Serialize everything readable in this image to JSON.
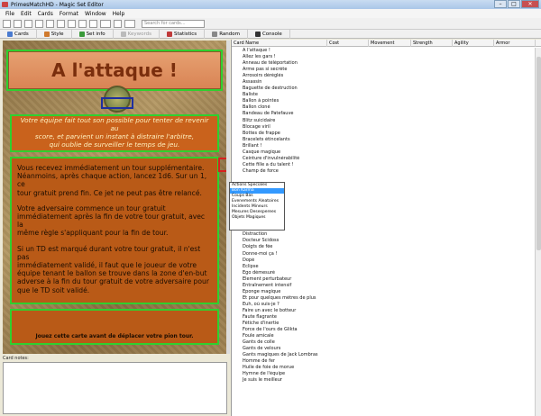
{
  "window": {
    "title": "PrimesMatchHD - Magic Set Editor",
    "buttons": [
      "–",
      "□",
      "✕"
    ]
  },
  "menu": [
    "File",
    "Edit",
    "Cards",
    "Format",
    "Window",
    "Help"
  ],
  "toolbar": {
    "search_placeholder": "Search for cards..."
  },
  "tabs": [
    {
      "label": "Cards",
      "icon": "cards-icon",
      "enabled": true
    },
    {
      "label": "Style",
      "icon": "style-icon",
      "enabled": true
    },
    {
      "label": "Set info",
      "icon": "set-info-icon",
      "enabled": true
    },
    {
      "label": "Keywords",
      "icon": "keywords-icon",
      "enabled": false
    },
    {
      "label": "Statistics",
      "icon": "statistics-icon",
      "enabled": true
    },
    {
      "label": "Random",
      "icon": "random-icon",
      "enabled": true
    },
    {
      "label": "Console",
      "icon": "console-icon",
      "enabled": true
    }
  ],
  "card": {
    "title": "A l'attaque !",
    "intro": "Votre équipe fait tout son possible pour tenter de revenir au\nscore, et parvient un instant à distraire l'arbitre,\nqui oublie de surveiller le temps de jeu.",
    "paragraphs": [
      "Vous recevez immédiatement un tour supplémentaire.\nNéanmoins, après chaque action, lancez 1d6. Sur un 1, ce\ntour gratuit prend fin. Ce jet ne peut pas être relancé.",
      "Votre adversaire commence un tour gratuit\nimmédiatement après la fin de votre tour gratuit, avec la\nmême règle s'appliquant pour la fin de tour.",
      "Si un TD est marqué durant votre tour gratuit, il n'est pas\nimmédiatement validé, il faut que le joueur de votre\néquipe tenant le ballon se trouve dans la zone d'en-but\nadverse à la fin du tour gratuit de votre adversaire pour\nque le TD soit validé."
    ],
    "footer": "Jouez cette carte avant de déplacer votre pion tour."
  },
  "notes_label": "Card notes:",
  "list": {
    "columns": [
      "Card Name",
      "Cost",
      "Movement",
      "Strength",
      "Agility",
      "Armor"
    ],
    "rows": [
      "A l'attaque !",
      "Allez les gars !",
      "Anneau de téléportation",
      "Arme pas si secrète",
      "Arrosoirs déréglés",
      "Assassin",
      "Baguette de destruction",
      "Baliste",
      "Ballon à pointes",
      "Ballon cloné",
      "Bandeau de Patefauve",
      "Blitz suicidaire",
      "Blocage viril",
      "Bottes de frappe",
      "Bracelets étincelants",
      "Brillant !",
      "Casque magique",
      "Ceinture d'invulnérabilité",
      "Cette fille a du talent !",
      "Champ de force",
      "",
      "",
      "",
      "",
      "",
      "",
      "",
      "",
      "Dégagement",
      "Distraction",
      "Docteur Scidoss",
      "Doigts de fée",
      "Donne-moi ça !",
      "Dopé",
      "Eclipse",
      "Ego démesuré",
      "Element perturbateur",
      "Entraînement intensif",
      "Eponge magique",
      "Et pour quelques mètres de plus",
      "Euh, où suis-je ?",
      "Faire un avec le botteur",
      "Faute flagrante",
      "Fétiche d'inertie",
      "Force de l'ours de Glikta",
      "Foule amicale",
      "Gants de colle",
      "Gants de velours",
      "Gants magiques de Jack Lombras",
      "Homme de fer",
      "Huile de foie de morue",
      "Hymne de l'équipe",
      "Je suis le meilleur"
    ]
  },
  "dropdown": {
    "items": [
      "Actions Speciales",
      "Bon Karma",
      "Coups Bas",
      "Evenements Aleatoires",
      "Incidents Mineurs",
      "Mesures Desesperees",
      "Objets Magiques"
    ],
    "selected_index": 1
  }
}
